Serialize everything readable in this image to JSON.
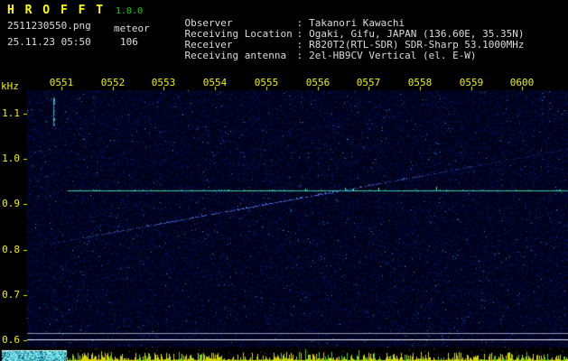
{
  "app": {
    "title": "H R O F F T",
    "version": "1.0.0"
  },
  "header": {
    "filename": "2511230550.png",
    "mode": "meteor",
    "datetime": "25.11.23 05:50",
    "count": "106",
    "sep": ":",
    "info": [
      {
        "label": "Observer",
        "value": "Takanori Kawachi"
      },
      {
        "label": "Receiving Location",
        "value": "Ogaki, Gifu, JAPAN (136.60E, 35.35N)"
      },
      {
        "label": "Receiver",
        "value": "R820T2(RTL-SDR) SDR-Sharp 53.1000MHz"
      },
      {
        "label": "Receiving antenna",
        "value": "2el-HB9CV Vertical (el. E-W)"
      }
    ]
  },
  "chart_data": {
    "type": "heatmap",
    "subtype": "radio-meteor-spectrogram",
    "x_axis": {
      "ticks": [
        "0551",
        "0552",
        "0553",
        "0554",
        "0555",
        "0556",
        "0557",
        "0558",
        "0559",
        "0600"
      ]
    },
    "y_axis": {
      "unit": "kHz",
      "ticks": [
        "1.1",
        "1.0",
        "0.9",
        "0.8",
        "0.7",
        "0.6"
      ],
      "range": [
        0.58,
        1.15
      ]
    },
    "features": {
      "carrier_khz": 0.93,
      "carrier_start_frac": 0.075,
      "drift_echo": {
        "start_frac": 0.042,
        "start_khz": 0.813,
        "end_frac": 0.999,
        "end_khz": 1.023
      },
      "meteor_echo": {
        "time_frac": 0.048,
        "top_khz": 1.135,
        "bottom_khz": 1.075
      },
      "boundary_lines_khz": [
        0.616,
        0.601
      ]
    },
    "colors": {
      "background": "#000000",
      "axis_text": "#f0f000",
      "carrier": "#28b48c",
      "carrier_bright": "#78ff96",
      "drift": "#4668e6",
      "boundary_dim": "#9696af",
      "boundary_bright": "#ebebf5",
      "strip_yellow": "#d7d700",
      "strip_green": "#5acd28",
      "level_block": "#6ee1e6"
    }
  }
}
